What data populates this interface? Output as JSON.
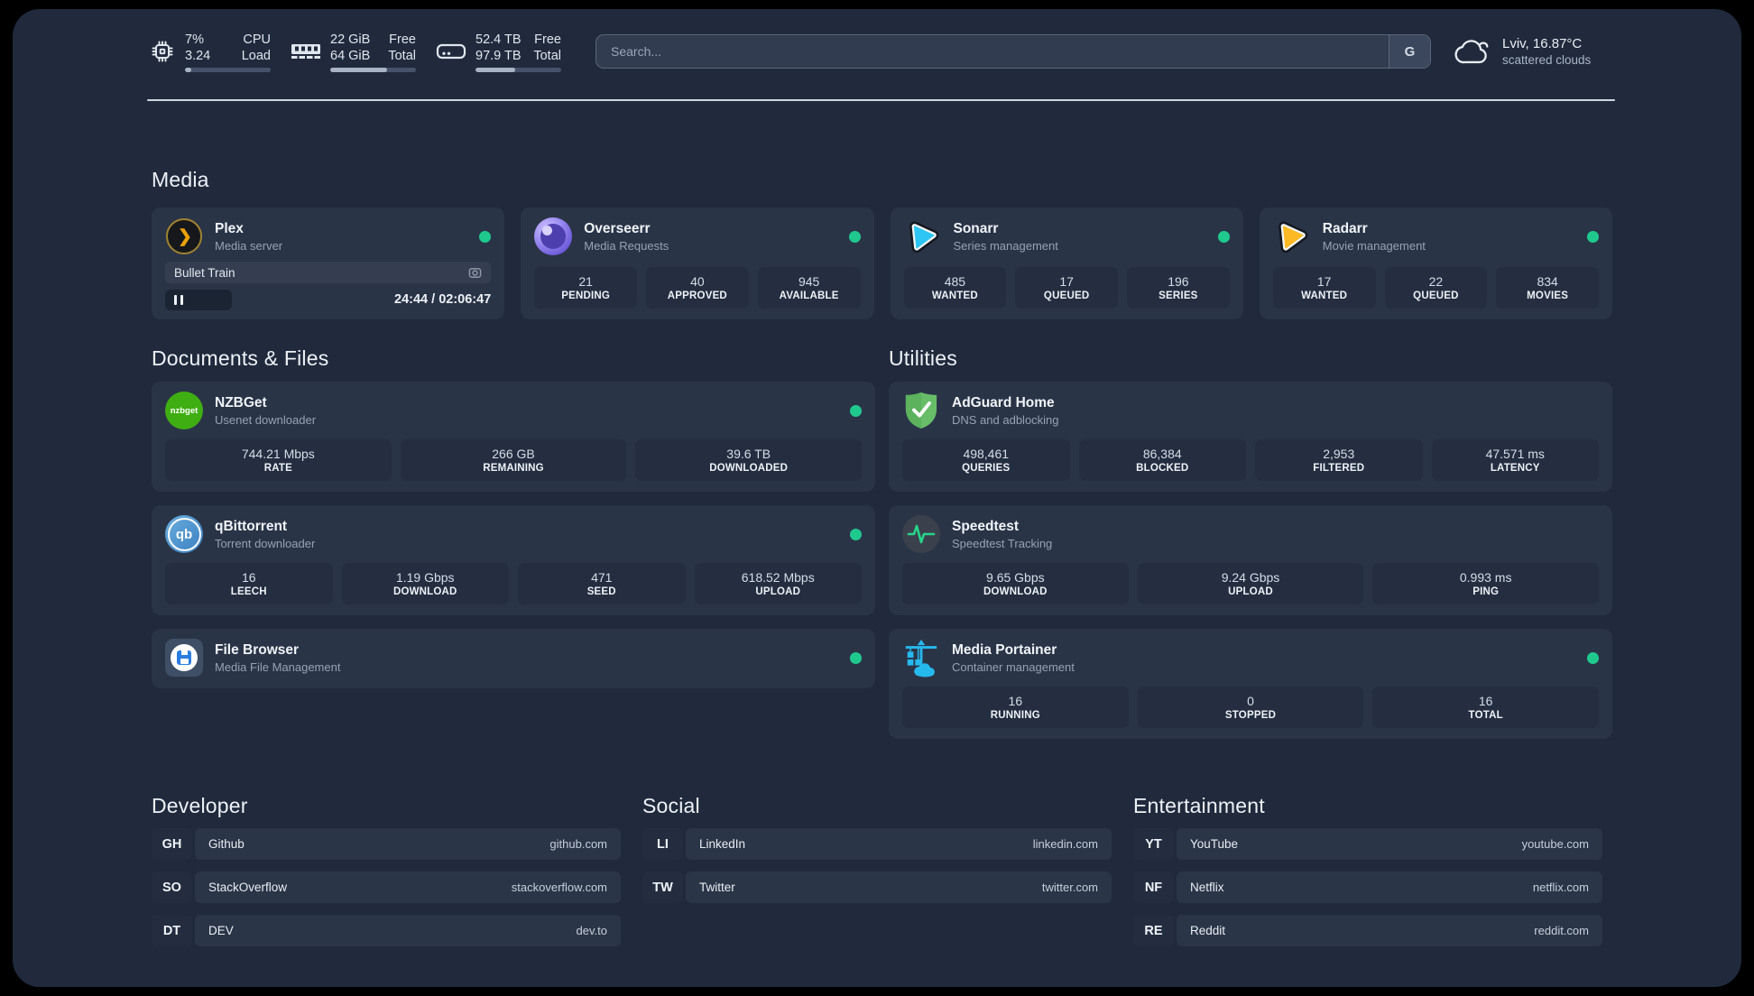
{
  "colors": {
    "status_green": "#1fc98e",
    "plex_gold": "#eba10a",
    "sonarr_blue": "#2dc5f3",
    "radarr_amber": "#fdb924",
    "nzbget_green": "#3fae13",
    "qbittorrent_blue": "#4f9bd9",
    "adguard_green": "#63b663",
    "portainer_blue": "#26b9ee"
  },
  "header": {
    "stats": [
      {
        "name": "cpu",
        "value1": "7%",
        "value2": "3.24",
        "label1": "CPU",
        "label2": "Load",
        "bar_percent": 7
      },
      {
        "name": "memory",
        "value1": "22 GiB",
        "value2": "64 GiB",
        "label1": "Free",
        "label2": "Total",
        "bar_percent": 66
      },
      {
        "name": "disk",
        "value1": "52.4 TB",
        "value2": "97.9 TB",
        "label1": "Free",
        "label2": "Total",
        "bar_percent": 46
      }
    ],
    "search": {
      "placeholder": "Search...",
      "provider_button": "G"
    },
    "weather": {
      "location_temp": "Lviv, 16.87°C",
      "condition": "scattered clouds"
    }
  },
  "sections": {
    "media": {
      "title": "Media",
      "cards": [
        {
          "name": "Plex",
          "subtitle": "Media server",
          "online": true,
          "now_playing": "Bullet Train",
          "time": "24:44 / 02:06:47"
        },
        {
          "name": "Overseerr",
          "subtitle": "Media Requests",
          "online": true,
          "stats": [
            {
              "value": "21",
              "label": "PENDING"
            },
            {
              "value": "40",
              "label": "APPROVED"
            },
            {
              "value": "945",
              "label": "AVAILABLE"
            }
          ]
        },
        {
          "name": "Sonarr",
          "subtitle": "Series management",
          "online": true,
          "stats": [
            {
              "value": "485",
              "label": "WANTED"
            },
            {
              "value": "17",
              "label": "QUEUED"
            },
            {
              "value": "196",
              "label": "SERIES"
            }
          ]
        },
        {
          "name": "Radarr",
          "subtitle": "Movie management",
          "online": true,
          "stats": [
            {
              "value": "17",
              "label": "WANTED"
            },
            {
              "value": "22",
              "label": "QUEUED"
            },
            {
              "value": "834",
              "label": "MOVIES"
            }
          ]
        }
      ]
    },
    "documents": {
      "title": "Documents & Files",
      "cards": [
        {
          "name": "NZBGet",
          "subtitle": "Usenet downloader",
          "online": true,
          "stats": [
            {
              "value": "744.21 Mbps",
              "label": "RATE"
            },
            {
              "value": "266 GB",
              "label": "REMAINING"
            },
            {
              "value": "39.6 TB",
              "label": "DOWNLOADED"
            }
          ]
        },
        {
          "name": "qBittorrent",
          "subtitle": "Torrent downloader",
          "online": true,
          "stats": [
            {
              "value": "16",
              "label": "LEECH"
            },
            {
              "value": "1.19 Gbps",
              "label": "DOWNLOAD"
            },
            {
              "value": "471",
              "label": "SEED"
            },
            {
              "value": "618.52 Mbps",
              "label": "UPLOAD"
            }
          ]
        },
        {
          "name": "File Browser",
          "subtitle": "Media File Management",
          "online": true
        }
      ]
    },
    "utilities": {
      "title": "Utilities",
      "cards": [
        {
          "name": "AdGuard Home",
          "subtitle": "DNS and adblocking",
          "stats": [
            {
              "value": "498,461",
              "label": "QUERIES"
            },
            {
              "value": "86,384",
              "label": "BLOCKED"
            },
            {
              "value": "2,953",
              "label": "FILTERED"
            },
            {
              "value": "47.571 ms",
              "label": "LATENCY"
            }
          ]
        },
        {
          "name": "Speedtest",
          "subtitle": "Speedtest Tracking",
          "stats": [
            {
              "value": "9.65 Gbps",
              "label": "DOWNLOAD"
            },
            {
              "value": "9.24 Gbps",
              "label": "UPLOAD"
            },
            {
              "value": "0.993 ms",
              "label": "PING"
            }
          ]
        },
        {
          "name": "Media Portainer",
          "subtitle": "Container management",
          "online": true,
          "stats": [
            {
              "value": "16",
              "label": "RUNNING"
            },
            {
              "value": "0",
              "label": "STOPPED"
            },
            {
              "value": "16",
              "label": "TOTAL"
            }
          ]
        }
      ]
    },
    "developer": {
      "title": "Developer",
      "links": [
        {
          "abbr": "GH",
          "name": "Github",
          "domain": "github.com"
        },
        {
          "abbr": "SO",
          "name": "StackOverflow",
          "domain": "stackoverflow.com"
        },
        {
          "abbr": "DT",
          "name": "DEV",
          "domain": "dev.to"
        }
      ]
    },
    "social": {
      "title": "Social",
      "links": [
        {
          "abbr": "LI",
          "name": "LinkedIn",
          "domain": "linkedin.com"
        },
        {
          "abbr": "TW",
          "name": "Twitter",
          "domain": "twitter.com"
        }
      ]
    },
    "entertainment": {
      "title": "Entertainment",
      "links": [
        {
          "abbr": "YT",
          "name": "YouTube",
          "domain": "youtube.com"
        },
        {
          "abbr": "NF",
          "name": "Netflix",
          "domain": "netflix.com"
        },
        {
          "abbr": "RE",
          "name": "Reddit",
          "domain": "reddit.com"
        }
      ]
    }
  }
}
